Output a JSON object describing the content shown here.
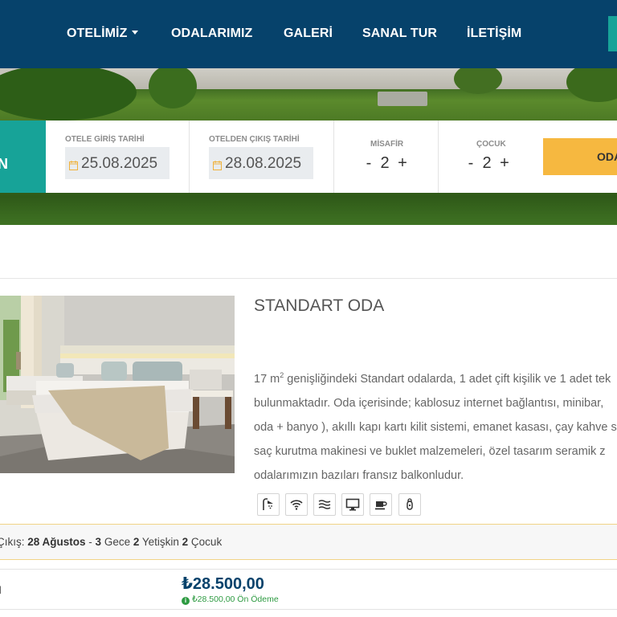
{
  "nav": {
    "items": [
      "OTELİMİZ",
      "ODALARIMIZ",
      "GALERİ",
      "SANAL TUR",
      "İLETİŞİM"
    ]
  },
  "booking": {
    "teal_letter": "N",
    "checkin_label": "OTELE GİRİŞ TARİHİ",
    "checkin_value": "25.08.2025",
    "checkout_label": "OTELDEN ÇIKIŞ TARİHİ",
    "checkout_value": "28.08.2025",
    "guests_label": "MİSAFİR",
    "guests_value": "2",
    "children_label": "ÇOCUK",
    "children_value": "2",
    "minus": "-",
    "plus": "+",
    "search_label": "ODA"
  },
  "room": {
    "title": "STANDART ODA",
    "desc_line1_pre": "17 m",
    "desc_line1_sup": "2",
    "desc_line1_post": " genişliğindeki Standart odalarda, 1 adet çift kişilik ve 1 adet tek",
    "desc_line2": "bulunmaktadır. Oda içerisinde; kablosuz internet bağlantısı, minibar,",
    "desc_line3": "oda + banyo ), akıllı kapı kartı kilit sistemi, emanet kasası, çay kahve s",
    "desc_line4": "saç kurutma makinesi ve buklet malzemeleri, özel tasarım seramik z",
    "desc_line5": "odalarımızın bazıları fransız balkonludur.",
    "amenities": [
      "shower-icon",
      "wifi-icon",
      "air-conditioning-icon",
      "tv-icon",
      "coffee-icon",
      "safe-icon"
    ]
  },
  "summary": {
    "prefix": "Çıkış: ",
    "checkout": "28 Ağustos",
    "sep1": " - ",
    "nights": "3",
    "nights_word": " Gece ",
    "adults": "2",
    "adults_word": " Yetişkin ",
    "children": "2",
    "children_word": " Çocuk"
  },
  "rate": {
    "label": "il",
    "price": "₺28.500,00",
    "prepay_icon": "i",
    "prepay_text": "₺28.500,00 Ön Ödeme"
  }
}
